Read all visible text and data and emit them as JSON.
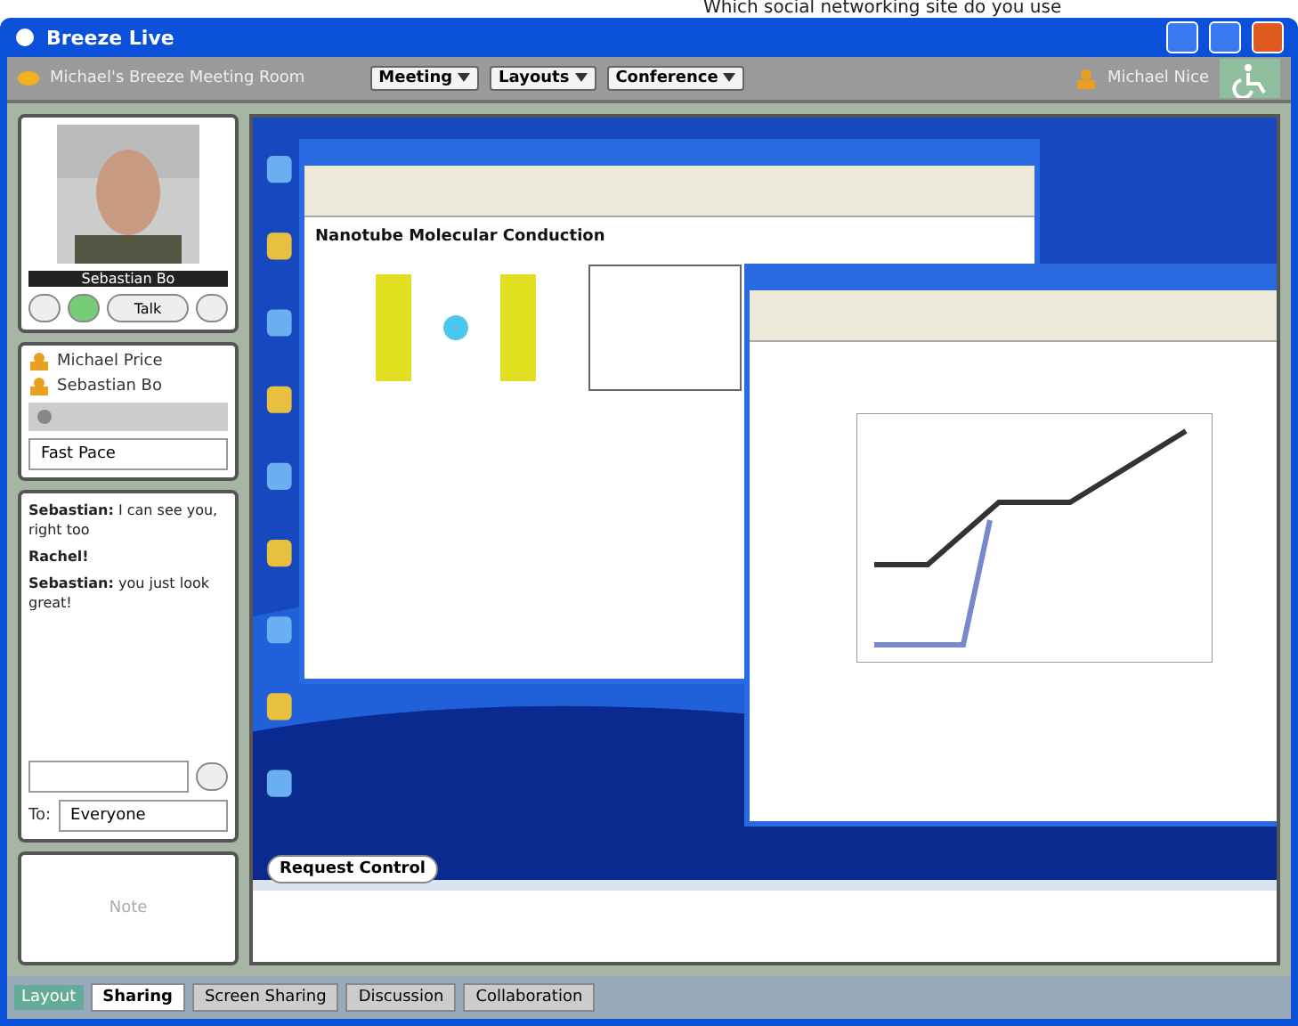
{
  "caption": "Which social networking site do you use",
  "window": {
    "title": "Breeze Live"
  },
  "toolbar": {
    "room": "Michael's Breeze Meeting Room",
    "menus": [
      "Meeting",
      "Layouts",
      "Conference"
    ],
    "user": "Michael Nice"
  },
  "video": {
    "name": "Sebastian Bo",
    "talk": "Talk"
  },
  "attendees": [
    {
      "name": "Michael Price"
    },
    {
      "name": "Sebastian Bo"
    }
  ],
  "status_select": "Fast Pace",
  "chat": {
    "messages": [
      {
        "sender": "Sebastian:",
        "text": "I can see you, right too"
      },
      {
        "sender": "Rachel!"
      },
      {
        "sender": "Sebastian:",
        "text": "you just look great!"
      }
    ],
    "to_label": "To:",
    "to": "Everyone"
  },
  "note": "Note",
  "shared_screen": {
    "heading": "Nanotube Molecular Conduction",
    "request_control": "Request Control"
  },
  "tabs": [
    {
      "label": "Sharing",
      "selected": true
    },
    {
      "label": "Screen Sharing",
      "selected": false
    },
    {
      "label": "Discussion",
      "selected": false
    },
    {
      "label": "Collaboration",
      "selected": false
    }
  ],
  "layout_label": "Layout"
}
